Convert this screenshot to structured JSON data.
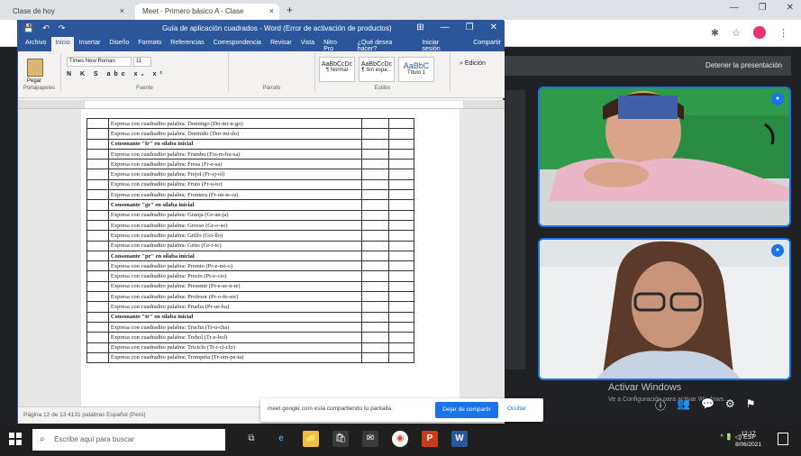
{
  "browser": {
    "tab1_title": "Clase de hoy",
    "tab2_title": "Meet - Primero básico A - Clase",
    "new_tab": "+",
    "close": "×",
    "window_controls": [
      "—",
      "❐",
      "✕"
    ]
  },
  "word": {
    "quick_access": [
      "💾",
      "↶",
      "↷"
    ],
    "title": "Guía de aplicación cuadrados - Word (Error de activación de productos)",
    "window_controls": [
      "⊞",
      "—",
      "❐",
      "✕"
    ],
    "tabs": [
      "Archivo",
      "Inicio",
      "Insertar",
      "Diseño",
      "Formato",
      "Referencias",
      "Correspondencia",
      "Revisar",
      "Vista",
      "Nitro Pro",
      "¿Qué desea hacer?",
      "Iniciar sesión",
      "Compartir"
    ],
    "ribbon": {
      "paste": "Pegar",
      "font_name": "Times New Roman",
      "font_size": "11",
      "format_buttons": "N K S abc x₂ x²",
      "styles": [
        {
          "preview": "AaBbCcDc",
          "name": "¶ Normal"
        },
        {
          "preview": "AaBbCcDc",
          "name": "¶ Sin espa..."
        },
        {
          "preview": "AaBbC",
          "name": "Título 1"
        }
      ],
      "editing": "Edición",
      "groups": [
        "Portapapeles",
        "Fuente",
        "Párrafo",
        "Estilos"
      ]
    },
    "rows": [
      {
        "type": "item",
        "text": "Expresa con cuadradito palabra: Domingo (Do-mi-n-go)"
      },
      {
        "type": "item",
        "text": "Expresa con cuadradito palabra: Dormido (Dor-mi-do)"
      },
      {
        "type": "head",
        "text": "Consonante \"fr\" en sílaba inicial"
      },
      {
        "type": "item",
        "text": "Expresa con cuadradito palabra: Frambu (Fra-m-bu-sa)"
      },
      {
        "type": "item",
        "text": "Expresa con cuadradito palabra: Fresa (Fr-e-sa)"
      },
      {
        "type": "item",
        "text": "Expresa con cuadradito palabra: Frejol (Fr-ej-ol)"
      },
      {
        "type": "item",
        "text": "Expresa con cuadradito palabra: Fruto (Fr-u-to)"
      },
      {
        "type": "item",
        "text": "Expresa con cuadradito palabra: Frontera (Fr-on-te-ra)"
      },
      {
        "type": "head",
        "text": "Consonante \"gr\" en sílaba inicial"
      },
      {
        "type": "item",
        "text": "Expresa con cuadradito palabra: Granja (Gr-an-ja)"
      },
      {
        "type": "item",
        "text": "Expresa con cuadradito palabra: Grosso (Gr-o-so)"
      },
      {
        "type": "item",
        "text": "Expresa con cuadradito palabra: Grillo (Gri-llo)"
      },
      {
        "type": "item",
        "text": "Expresa con cuadradito palabra: Grito (Gr-i-to)"
      },
      {
        "type": "head",
        "text": "Consonante \"pr\" en sílaba inicial"
      },
      {
        "type": "item",
        "text": "Expresa con cuadradito palabra: Premio (Pr-e-mi-o)"
      },
      {
        "type": "item",
        "text": "Expresa con cuadradito palabra: Precio (Pr-e-cio)"
      },
      {
        "type": "item",
        "text": "Expresa con cuadradito palabra: Presente (Pr-e-se-n-te)"
      },
      {
        "type": "item",
        "text": "Expresa con cuadradito palabra: Profesor (Pr-o-fe-sor)"
      },
      {
        "type": "item",
        "text": "Expresa con cuadradito palabra: Prueba (Pr-ue-ba)"
      },
      {
        "type": "head",
        "text": "Consonante \"tr\" en sílaba inicial"
      },
      {
        "type": "item",
        "text": "Expresa con cuadradito palabra: Trucha (Tr-u-cha)"
      },
      {
        "type": "item",
        "text": "Expresa con cuadradito palabra: Trebol (Tr-e-bol)"
      },
      {
        "type": "item",
        "text": "Expresa con cuadradito palabra: Triciclo (Tr-i-ci-clo)"
      },
      {
        "type": "item",
        "text": "Expresa con cuadradito palabra: Trompeta (Tr-om-pe-ta)"
      }
    ],
    "status": "Página 12 de 13    4131 palabras    Español (Perú)"
  },
  "meet": {
    "present_banner": "Detener la presentación",
    "activate_title": "Activar Windows",
    "activate_sub": "Ve a Configuración para activar Windows.",
    "tile_badge": "●",
    "tools": [
      "ⓘ",
      "👥",
      "💬",
      "⚙",
      "⚑"
    ]
  },
  "share_bar": {
    "text": "meet.google.com está compartiendo tu pantalla.",
    "stop": "Dejar de compartir",
    "hide": "Ocultar"
  },
  "taskbar": {
    "search_placeholder": "Escribe aquí para buscar",
    "search_icon": "⌕",
    "apps": [
      "⧉",
      "e",
      "📁",
      "🛍",
      "✉",
      "◉",
      "P",
      "W"
    ],
    "tray": "^  🔋  ◁)  ESP",
    "time": "12:17",
    "date": "8/06/2021"
  },
  "colors": {
    "word_blue": "#2b579a",
    "meet_bg": "#202124",
    "accent_blue": "#1a73e8"
  }
}
